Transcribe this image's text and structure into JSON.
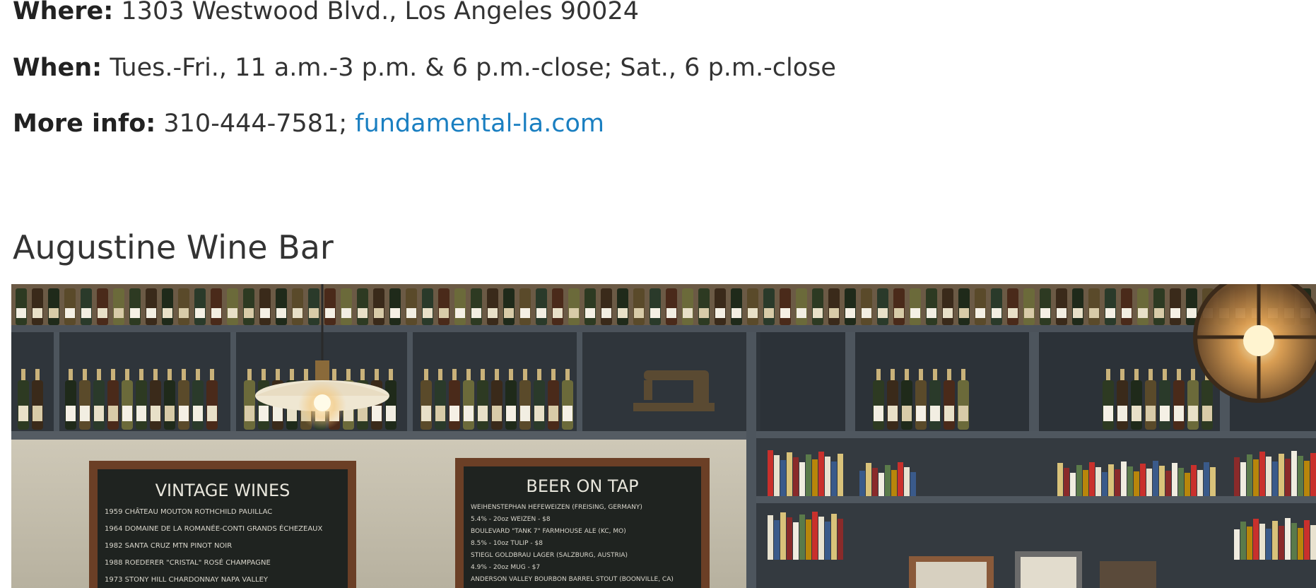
{
  "details": {
    "where_label": "Where:",
    "where_value": "1303 Westwood Blvd., Los Angeles 90024",
    "when_label": "When:",
    "when_value": "Tues.-Fri., 11 a.m.-3 p.m. & 6 p.m.-close; Sat., 6 p.m.-close",
    "more_label": "More info:",
    "more_phone": "310-444-7581; ",
    "more_link": "fundamental-la.com"
  },
  "section": {
    "heading": "Augustine Wine Bar"
  },
  "photo": {
    "board_left": {
      "title": "VINTAGE WINES",
      "lines": [
        "1959 CHÂTEAU MOUTON ROTHCHILD PAUILLAC",
        "1964 DOMAINE DE LA ROMANÉE-CONTI GRANDS ÉCHEZEAUX",
        "1982 SANTA CRUZ MTN PINOT NOIR",
        "1988 ROEDERER \"CRISTAL\" ROSÉ CHAMPAGNE",
        "1973 STONY HILL CHARDONNAY NAPA VALLEY"
      ]
    },
    "board_right": {
      "title": "BEER ON TAP",
      "lines": [
        "WEIHENSTEPHAN HEFEWEIZEN (FREISING, GERMANY)",
        "5.4% - 20oz WEIZEN - $8",
        "BOULEVARD \"TANK 7\" FARMHOUSE ALE (KC, MO)",
        "8.5% - 10oz TULIP - $8",
        "STIEGL GOLDBRAU LAGER (SALZBURG, AUSTRIA)",
        "4.9% - 20oz MUG - $7",
        "ANDERSON VALLEY BOURBON BARREL STOUT (BOONVILLE, CA)"
      ]
    }
  }
}
